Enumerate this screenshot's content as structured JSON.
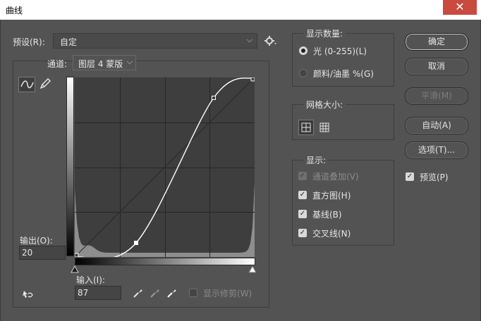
{
  "window": {
    "title": "曲线",
    "close_glyph": "✕"
  },
  "preset": {
    "label": "预设(R):",
    "value": "自定"
  },
  "channel": {
    "label": "通道:",
    "value": "图层 4 蒙版"
  },
  "display_amount": {
    "title": "显示数量:",
    "options": [
      {
        "label": "光 (0-255)(L)",
        "selected": true
      },
      {
        "label": "颜料/油墨 %(G)",
        "selected": false
      }
    ]
  },
  "grid_size": {
    "title": "网格大小:"
  },
  "show": {
    "title": "显示:",
    "options": [
      {
        "label": "通道叠加(V)",
        "checked": true,
        "disabled": true
      },
      {
        "label": "直方图(H)",
        "checked": true,
        "disabled": false
      },
      {
        "label": "基线(B)",
        "checked": true,
        "disabled": false
      },
      {
        "label": "交叉线(N)",
        "checked": true,
        "disabled": false
      }
    ]
  },
  "buttons": {
    "ok": "确定",
    "cancel": "取消",
    "smooth": "平滑(M)",
    "auto": "自动(A)",
    "options": "选项(T)..."
  },
  "preview": {
    "label": "预览(P)",
    "checked": true
  },
  "output": {
    "label": "输出(O):",
    "value": "20"
  },
  "input": {
    "label": "输入(I):",
    "value": "87"
  },
  "show_clipping": {
    "label": "显示修剪(W)",
    "checked": false
  },
  "curve": {
    "range": [
      0,
      255
    ],
    "points": [
      [
        0,
        0
      ],
      [
        87,
        20
      ],
      [
        197,
        226
      ],
      [
        255,
        255
      ]
    ],
    "selected_point": [
      87,
      20
    ]
  },
  "colors": {
    "accent_border": "#c8c8c8",
    "curve": "#ffffff"
  }
}
